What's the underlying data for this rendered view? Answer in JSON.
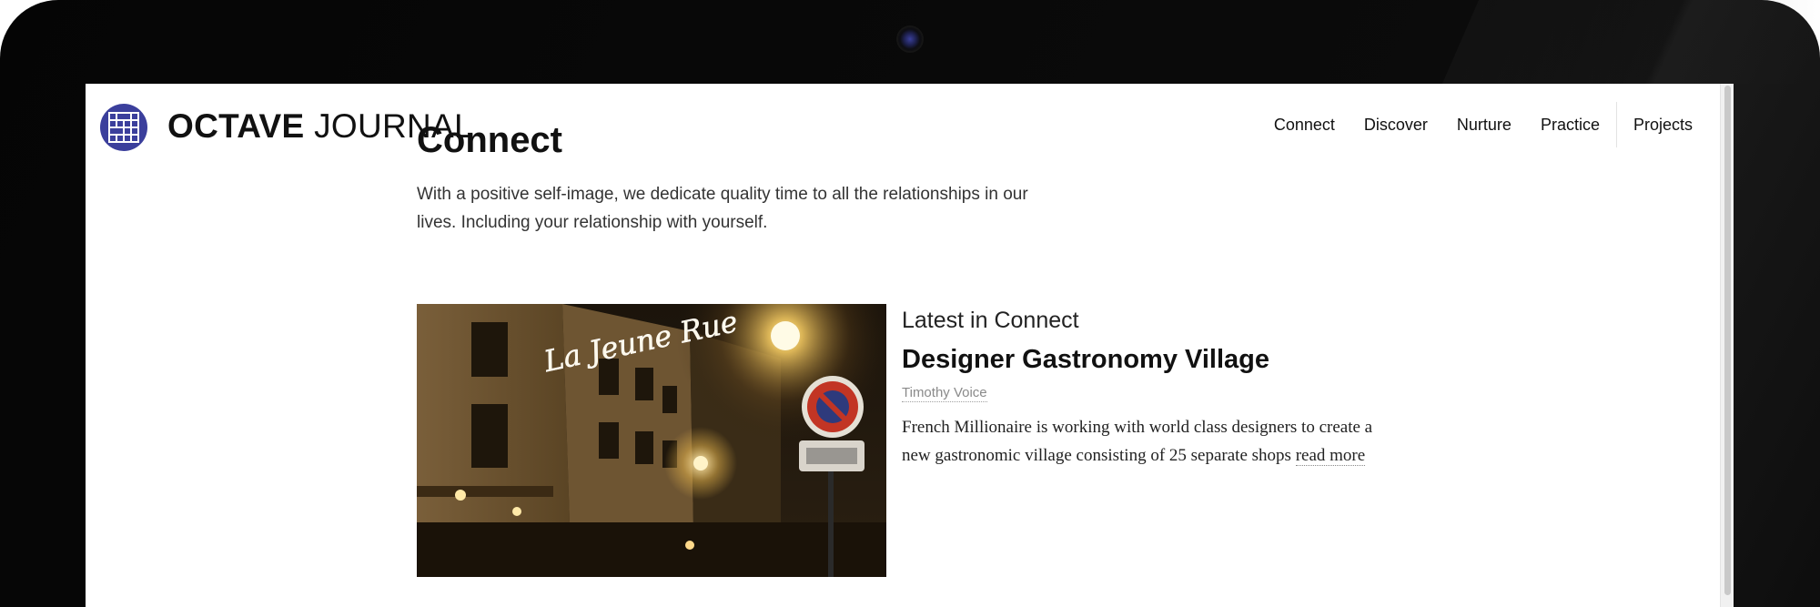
{
  "site": {
    "title_bold": "OCTAVE",
    "title_light": "JOURNAL"
  },
  "nav": {
    "items": [
      "Connect",
      "Discover",
      "Nurture",
      "Practice",
      "Projects"
    ]
  },
  "page": {
    "title": "Connect",
    "description": "With a positive self-image, we dedicate quality time to all the relationships in our lives. Including your relationship with yourself."
  },
  "feature": {
    "kicker": "Latest in Connect",
    "title": "Designer Gastronomy Village",
    "author": "Timothy Voice",
    "excerpt": "French Millionaire is working with world class designers to create a new gastronomic village consisting of 25 separate shops",
    "read_more": "read more",
    "image_neon_sign": "La Jeune Rue"
  },
  "colors": {
    "logo_blue": "#3b3f9c",
    "bezel": "#050505",
    "text": "#111111",
    "muted": "#8a8a8a"
  },
  "icons": {
    "logo": "grid-logo-icon",
    "camera": "camera-icon"
  }
}
